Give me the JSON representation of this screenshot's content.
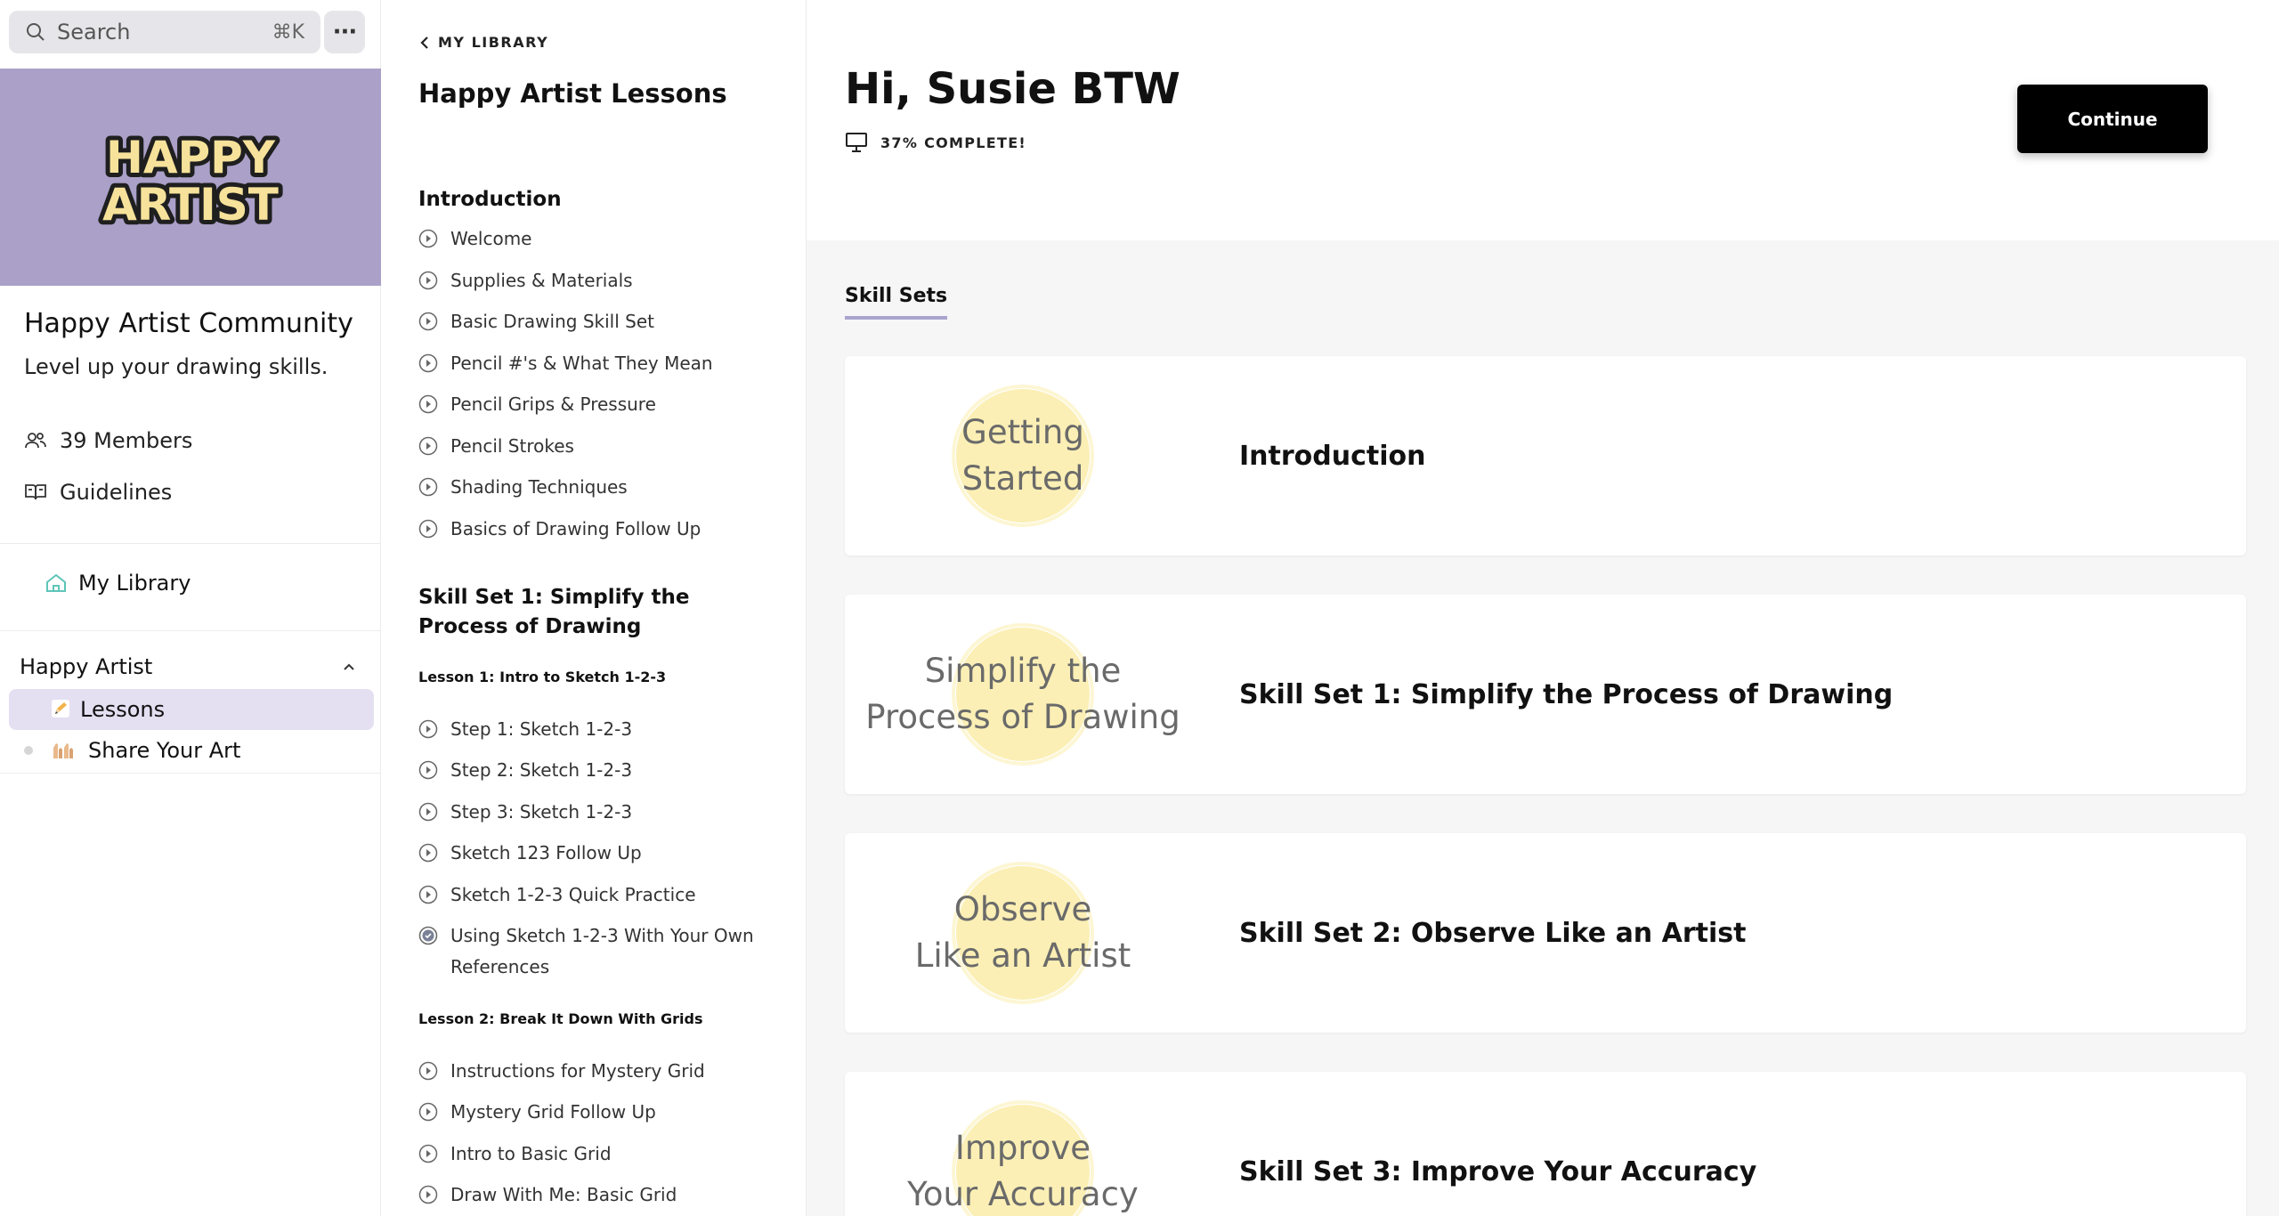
{
  "search": {
    "placeholder": "Search",
    "shortcut": "⌘K"
  },
  "community": {
    "name": "Happy Artist Community",
    "tagline": "Level up your drawing skills.",
    "banner_colors": {
      "background": "#aaa0c8",
      "logo_fill": "#f6e29a",
      "logo_outline": "#1f1f1f"
    }
  },
  "sidebar": {
    "members_label": "39 Members",
    "guidelines_label": "Guidelines",
    "my_library_label": "My Library",
    "group_name": "Happy Artist",
    "items": [
      {
        "label": "Lessons",
        "icon": "pencil-emoji-icon",
        "active": true
      },
      {
        "label": "Share Your Art",
        "icon": "raised-hands-emoji-icon",
        "active": false
      }
    ]
  },
  "course_nav": {
    "back_label": "MY LIBRARY",
    "title": "Happy Artist Lessons",
    "sections": [
      {
        "title": "Introduction",
        "items": [
          "Welcome",
          "Supplies & Materials",
          "Basic Drawing Skill Set",
          "Pencil #'s & What They Mean",
          "Pencil Grips & Pressure",
          "Pencil Strokes",
          "Shading Techniques",
          "Basics of Drawing Follow Up"
        ]
      },
      {
        "title": "Skill Set 1: Simplify the Process of Drawing",
        "lessons": [
          {
            "title": "Lesson 1: Intro to Sketch 1-2-3",
            "items": [
              "Step 1: Sketch 1-2-3",
              "Step 2: Sketch 1-2-3",
              "Step 3: Sketch 1-2-3",
              "Sketch 123 Follow Up",
              "Sketch 1-2-3 Quick Practice",
              "Using Sketch 1-2-3 With Your Own References"
            ]
          },
          {
            "title": "Lesson 2: Break It Down With Grids",
            "items": [
              "Instructions for Mystery Grid",
              "Mystery Grid Follow Up",
              "Intro to Basic Grid",
              "Draw With Me: Basic Grid"
            ]
          }
        ]
      }
    ]
  },
  "main": {
    "greeting": "Hi, Susie BTW",
    "progress_label": "37% COMPLETE!",
    "progress_percent": 37,
    "continue_label": "Continue",
    "tab_label": "Skill Sets",
    "cards": [
      {
        "thumb_text": "Getting\nStarted",
        "title": "Introduction"
      },
      {
        "thumb_text": "Simplify the\nProcess of Drawing",
        "title": "Skill Set 1: Simplify the Process of Drawing"
      },
      {
        "thumb_text": "Observe\nLike an Artist",
        "title": "Skill Set 2: Observe Like an Artist"
      },
      {
        "thumb_text": "Improve\nYour Accuracy",
        "title": "Skill Set 3: Improve Your Accuracy"
      }
    ]
  },
  "colors": {
    "accent_lavender": "#a9a4cd",
    "active_item_bg": "#e4e0f2",
    "thumb_circle": "#fbefb5",
    "button_bg": "#000000"
  }
}
